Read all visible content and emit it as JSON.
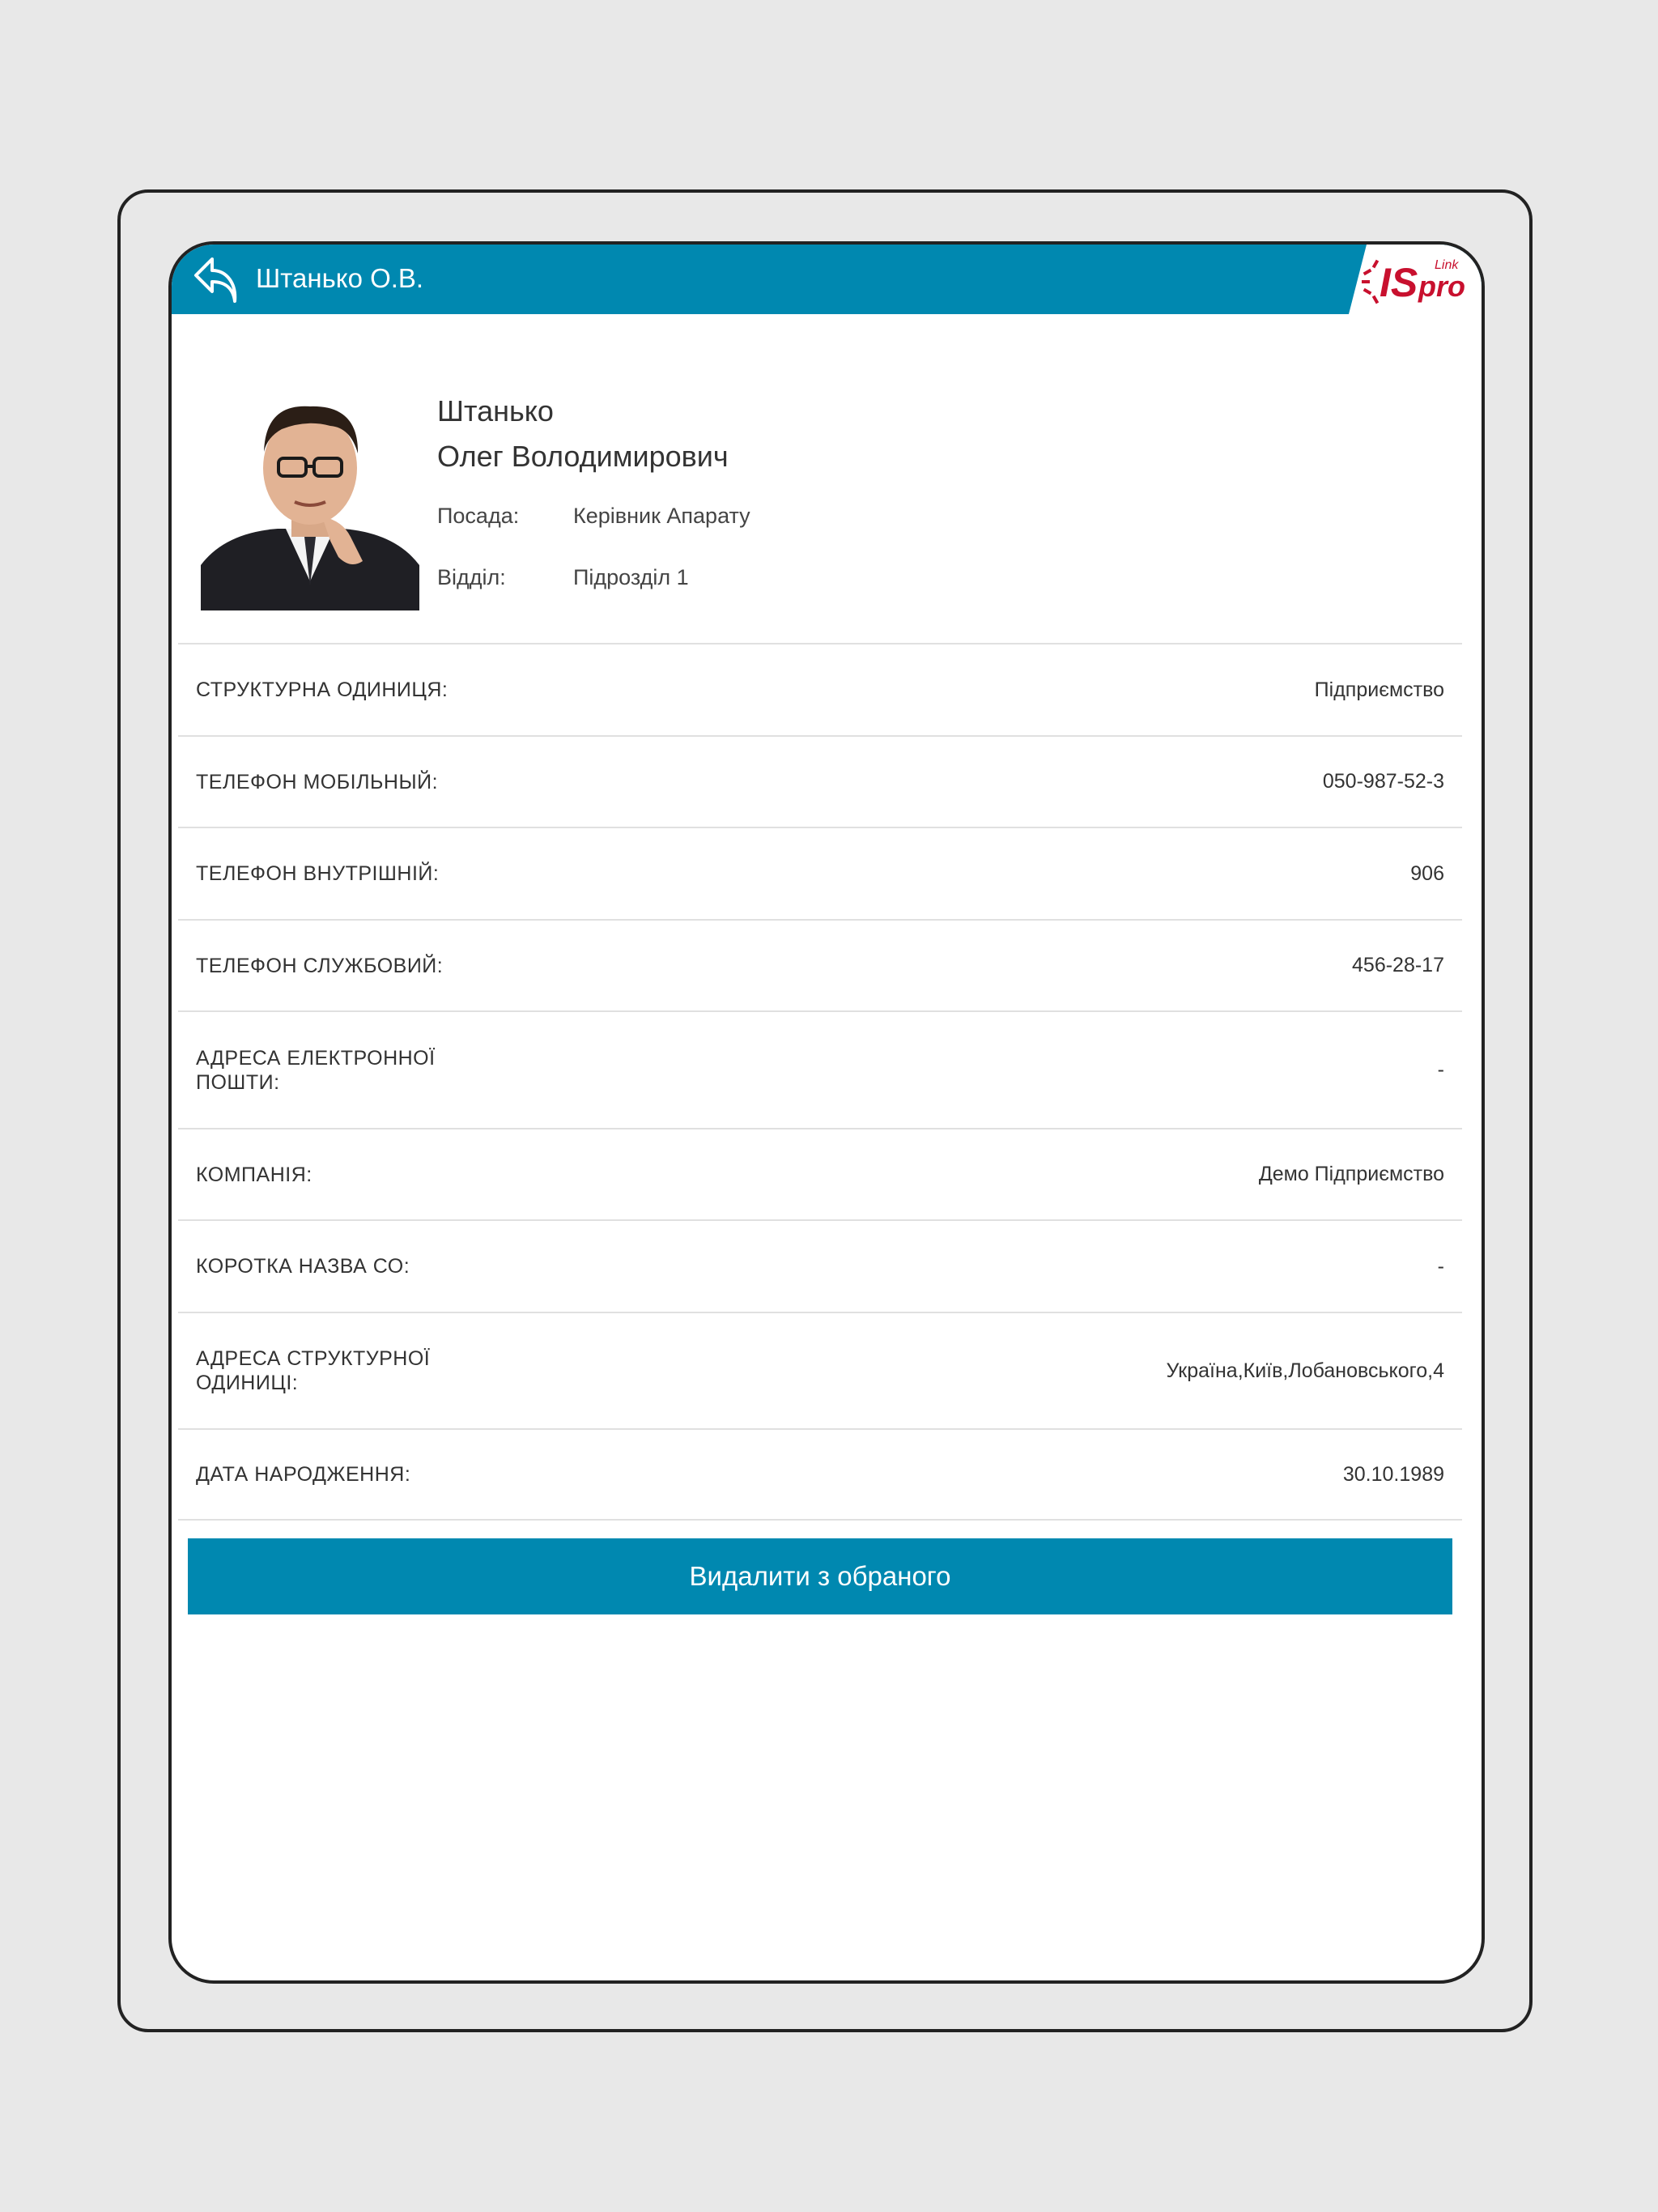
{
  "header": {
    "title": "Штанько О.В.",
    "logo_text": "ISpro",
    "logo_small": "Link"
  },
  "profile": {
    "surname": "Штанько",
    "given_names": "Олег Володимирович",
    "position_label": "Посада:",
    "position_value": "Керівник Апарату",
    "department_label": "Відділ:",
    "department_value": "Підрозділ 1"
  },
  "details": [
    {
      "label": "СТРУКТУРНА ОДИНИЦЯ:",
      "value": "Підприємство"
    },
    {
      "label": "ТЕЛЕФОН МОБІЛЬНЫЙ:",
      "value": "050-987-52-3"
    },
    {
      "label": "ТЕЛЕФОН ВНУТРІШНІЙ:",
      "value": "906"
    },
    {
      "label": "ТЕЛЕФОН СЛУЖБОВИЙ:",
      "value": "456-28-17"
    },
    {
      "label": "АДРЕСА ЕЛЕКТРОННОЇ ПОШТИ:",
      "value": "-"
    },
    {
      "label": "КОМПАНІЯ:",
      "value": "Демо Підприємство"
    },
    {
      "label": "КОРОТКА НАЗВА СО:",
      "value": "-"
    },
    {
      "label": "АДРЕСА СТРУКТУРНОЇ ОДИНИЦІ:",
      "value": "Україна,Київ,Лобановського,4"
    },
    {
      "label": "ДАТА НАРОДЖЕННЯ:",
      "value": "30.10.1989"
    }
  ],
  "actions": {
    "remove_favorite_label": "Видалити з обраного"
  },
  "colors": {
    "accent": "#0088b0",
    "logo_red": "#c8102e",
    "background": "#e8e8e8"
  },
  "icons": {
    "back": "back-arrow-icon",
    "logo": "ispro-logo"
  }
}
